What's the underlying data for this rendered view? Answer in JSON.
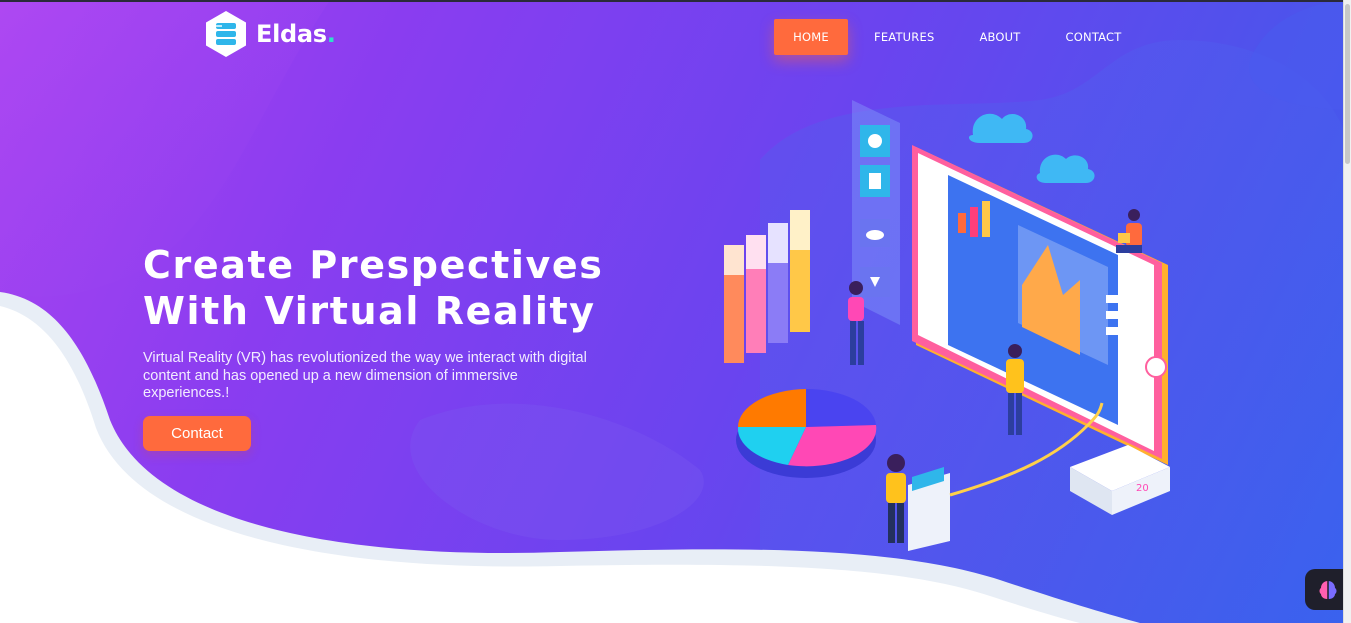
{
  "brand": {
    "name": "Eldas",
    "dot": ".",
    "logo_icon": "stacked-layers-hexagon-icon",
    "accent_dot_color": "#2ee2c8"
  },
  "nav": {
    "items": [
      {
        "label": "HOME",
        "active": true
      },
      {
        "label": "FEATURES",
        "active": false
      },
      {
        "label": "ABOUT",
        "active": false
      },
      {
        "label": "CONTACT",
        "active": false
      }
    ]
  },
  "hero": {
    "title_line1": "Create Prespectives",
    "title_line2": "With Virtual Reality",
    "description": "Virtual Reality (VR) has revolutionized the way we interact with digital content and has opened up a new dimension of immersive experiences.!",
    "cta_label": "Contact"
  },
  "colors": {
    "accent": "#ff6a3d",
    "gradient_start": "#a944f0",
    "gradient_end": "#3860ee",
    "text": "#ffffff"
  },
  "illustration": {
    "name": "isometric-vr-dashboard-illustration",
    "tablet_label": "20"
  },
  "floating_widget": {
    "icon": "brain-icon"
  }
}
